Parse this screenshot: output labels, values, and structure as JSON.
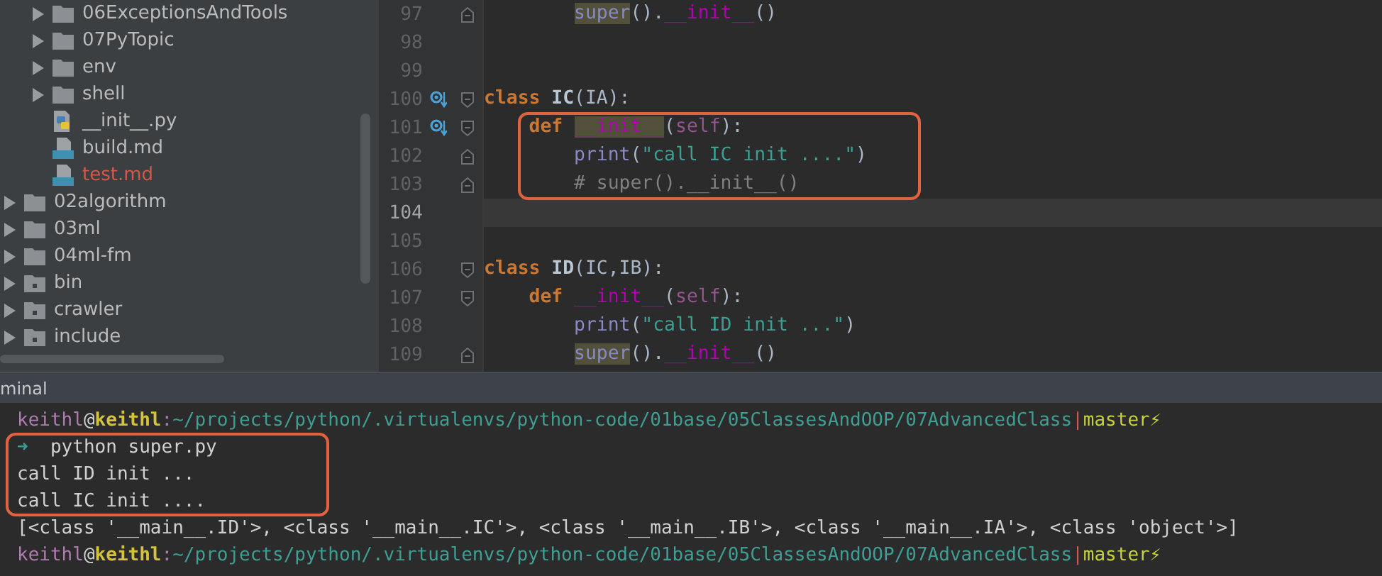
{
  "project_tree": [
    {
      "children": [
        {
          "label": "06ExceptionsAndTools",
          "kind": "folder",
          "expanded": false,
          "untracked": false
        },
        {
          "label": "07PyTopic",
          "kind": "folder",
          "expanded": false,
          "untracked": false
        },
        {
          "label": "env",
          "kind": "folder",
          "expanded": false,
          "untracked": false
        },
        {
          "label": "shell",
          "kind": "folder",
          "expanded": false,
          "untracked": false
        },
        {
          "label": "__init__.py",
          "kind": "python_file",
          "untracked": false
        },
        {
          "label": "build.md",
          "kind": "markdown_file",
          "untracked": false
        },
        {
          "label": "test.md",
          "kind": "markdown_file",
          "untracked": true
        }
      ]
    },
    {
      "label": "02algorithm",
      "kind": "folder",
      "expanded": false,
      "untracked": false
    },
    {
      "label": "03ml",
      "kind": "folder",
      "expanded": false,
      "untracked": false
    },
    {
      "label": "04ml-fm",
      "kind": "folder",
      "expanded": false,
      "untracked": false
    },
    {
      "label": "bin",
      "kind": "module_folder",
      "expanded": false,
      "untracked": false
    },
    {
      "label": "crawler",
      "kind": "module_folder",
      "expanded": false,
      "untracked": false
    },
    {
      "label": "include",
      "kind": "module_folder",
      "expanded": false,
      "untracked": false
    }
  ],
  "editor": {
    "lines": [
      {
        "children": [
          {
            "children": [
              {
                "number": "97",
                "override_marker": false,
                "fold_start": false,
                "fold_end": true,
                "current": false,
                "boxed": false,
                "tokens": [
                  {
                    "kind": "builtin",
                    "text": "super",
                    "marked": true
                  },
                  {
                    "kind": "text",
                    "text": "().",
                    "marked": false
                  },
                  {
                    "kind": "dunder",
                    "text": "__init__",
                    "marked": false
                  },
                  {
                    "kind": "text",
                    "text": "()",
                    "marked": false
                  }
                ]
              }
            ]
          }
        ]
      },
      {
        "number": "98",
        "override_marker": false,
        "fold_start": false,
        "fold_end": false,
        "current": false,
        "boxed": false
      },
      {
        "number": "99",
        "override_marker": false,
        "fold_start": false,
        "fold_end": false,
        "current": false,
        "boxed": false
      },
      {
        "number": "100",
        "override_marker": true,
        "fold_start": true,
        "fold_end": false,
        "current": false,
        "boxed": false,
        "tokens": [
          {
            "kind": "keyword",
            "text": "class",
            "marked": false
          },
          {
            "kind": "classname",
            "text": "IC",
            "marked": false
          },
          {
            "kind": "text",
            "text": "(IA):",
            "marked": false
          }
        ],
        "children": [
          {
            "number": "101",
            "override_marker": true,
            "fold_start": true,
            "fold_end": false,
            "current": false,
            "boxed": true,
            "tokens": [
              {
                "kind": "keyword",
                "text": "def",
                "marked": false
              },
              {
                "kind": "dunder",
                "text": "__init__",
                "marked": true
              },
              {
                "kind": "text",
                "text": "(",
                "marked": false
              },
              {
                "kind": "self",
                "text": "self",
                "marked": false
              },
              {
                "kind": "text",
                "text": "):",
                "marked": false
              }
            ],
            "children": [
              {
                "number": "102",
                "override_marker": false,
                "fold_start": false,
                "fold_end": true,
                "current": false,
                "boxed": false,
                "tokens": [
                  {
                    "kind": "builtin",
                    "text": "print",
                    "marked": false
                  },
                  {
                    "kind": "text",
                    "text": "(",
                    "marked": false
                  },
                  {
                    "kind": "string",
                    "text": "\"call IC init ....\"",
                    "marked": false
                  },
                  {
                    "kind": "text",
                    "text": ")",
                    "marked": false
                  }
                ]
              },
              {
                "number": "103",
                "override_marker": false,
                "fold_start": false,
                "fold_end": true,
                "current": false,
                "boxed": false,
                "tokens": [
                  {
                    "kind": "comment",
                    "text": "# super().__init__()",
                    "marked": false
                  }
                ]
              }
            ]
          }
        ]
      },
      {
        "number": "104",
        "override_marker": false,
        "fold_start": false,
        "fold_end": false,
        "current": true,
        "boxed": false
      },
      {
        "number": "105",
        "override_marker": false,
        "fold_start": false,
        "fold_end": false,
        "current": false,
        "boxed": false
      },
      {
        "number": "106",
        "override_marker": false,
        "fold_start": true,
        "fold_end": false,
        "current": false,
        "boxed": false,
        "tokens": [
          {
            "kind": "keyword",
            "text": "class",
            "marked": false
          },
          {
            "kind": "classname",
            "text": "ID",
            "marked": false
          },
          {
            "kind": "text",
            "text": "(IC,IB):",
            "marked": false
          }
        ],
        "children": [
          {
            "number": "107",
            "override_marker": false,
            "fold_start": true,
            "fold_end": false,
            "current": false,
            "boxed": false,
            "tokens": [
              {
                "kind": "keyword",
                "text": "def",
                "marked": false
              },
              {
                "kind": "dunder",
                "text": "__init__",
                "marked": false
              },
              {
                "kind": "text",
                "text": "(",
                "marked": false
              },
              {
                "kind": "self",
                "text": "self",
                "marked": false
              },
              {
                "kind": "text",
                "text": "):",
                "marked": false
              }
            ],
            "children": [
              {
                "number": "108",
                "override_marker": false,
                "fold_start": false,
                "fold_end": false,
                "current": false,
                "boxed": false,
                "tokens": [
                  {
                    "kind": "builtin",
                    "text": "print",
                    "marked": false
                  },
                  {
                    "kind": "text",
                    "text": "(",
                    "marked": false
                  },
                  {
                    "kind": "string",
                    "text": "\"call ID init ...\"",
                    "marked": false
                  },
                  {
                    "kind": "text",
                    "text": ")",
                    "marked": false
                  }
                ]
              },
              {
                "number": "109",
                "override_marker": false,
                "fold_start": false,
                "fold_end": true,
                "current": false,
                "boxed": false,
                "tokens": [
                  {
                    "kind": "builtin",
                    "text": "super",
                    "marked": true
                  },
                  {
                    "kind": "text",
                    "text": "().",
                    "marked": false
                  },
                  {
                    "kind": "dunder",
                    "text": "__init__",
                    "marked": false
                  },
                  {
                    "kind": "text",
                    "text": "()",
                    "marked": false
                  }
                ]
              }
            ]
          }
        ]
      }
    ]
  },
  "terminal": {
    "title": "minal",
    "blocks": [
      {
        "boxed": false,
        "lines": [
          {
            "segments": [
              {
                "kind": "user",
                "text": "keithl"
              },
              {
                "kind": "plain",
                "text": "@"
              },
              {
                "kind": "host",
                "text": "keithl"
              },
              {
                "kind": "user",
                "text": ":"
              },
              {
                "kind": "path",
                "text": "~/projects/python/.virtualenvs/python-code/01base/05ClassesAndOOP/07AdvancedClass"
              },
              {
                "kind": "separator",
                "text": "|"
              },
              {
                "kind": "branch",
                "text": "master⚡"
              }
            ]
          }
        ]
      },
      {
        "boxed": true,
        "lines": [
          {
            "segments": [
              {
                "kind": "arrow",
                "text": "➜"
              },
              {
                "kind": "plain",
                "text": "  python super.py"
              }
            ]
          },
          {
            "segments": [
              {
                "kind": "plain",
                "text": "call ID init ..."
              }
            ]
          },
          {
            "segments": [
              {
                "kind": "plain",
                "text": "call IC init ...."
              }
            ]
          }
        ]
      },
      {
        "boxed": false,
        "lines": [
          {
            "segments": [
              {
                "kind": "plain",
                "text": "[<class '__main__.ID'>, <class '__main__.IC'>, <class '__main__.IB'>, <class '__main__.IA'>, <class 'object'>]"
              }
            ]
          },
          {
            "segments": [
              {
                "kind": "user",
                "text": "keithl"
              },
              {
                "kind": "plain",
                "text": "@"
              },
              {
                "kind": "host",
                "text": "keithl"
              },
              {
                "kind": "user",
                "text": ":"
              },
              {
                "kind": "path",
                "text": "~/projects/python/.virtualenvs/python-code/01base/05ClassesAndOOP/07AdvancedClass"
              },
              {
                "kind": "separator",
                "text": "|"
              },
              {
                "kind": "branch",
                "text": "master⚡"
              }
            ]
          }
        ]
      }
    ]
  }
}
